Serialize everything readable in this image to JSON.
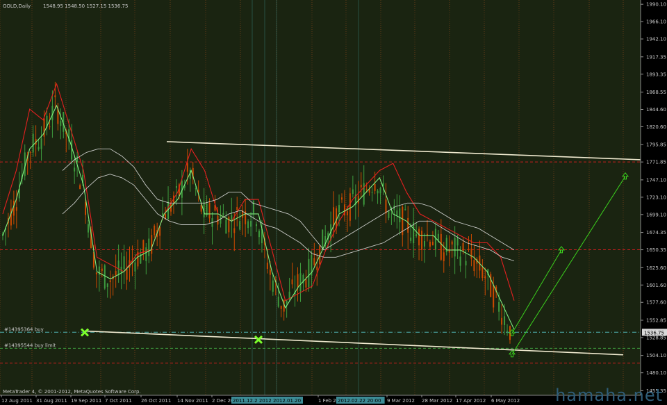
{
  "header": {
    "symbol": "GOLD,Daily",
    "ohlc": "1548.95  1548.50  1527.15  1536.75"
  },
  "footer": {
    "copyright": "MetaTrader 4, © 2001-2012, MetaQuotes Software Corp."
  },
  "watermark": "hamaha.net",
  "order_labels": [
    {
      "text": "#14395364 buy",
      "price": 1536.2
    },
    {
      "text": "#14395544 buy limit",
      "price": 1514.0
    }
  ],
  "time_markers": [
    "2011.12.2 2012.01",
    "2012.01.20",
    "2012.02.22 20:00"
  ],
  "colors": {
    "background": "#000000",
    "plot_background": "#1a2411",
    "axis_text": "#c8c8c8",
    "grid": "#c85a1e",
    "candle_up": "#3e9b3e",
    "candle_down": "#cc4a00",
    "ma_red": "#e52020",
    "ma_green": "#80ee80",
    "envelope": "#e8e8e8",
    "trend_line": "#f0ead0",
    "dashed_red": "#c81e1e",
    "dashed_cyan": "#4fb4b4",
    "dashed_green": "#40a040",
    "cross_marker": "#7cff2c",
    "arrow_green": "#3cd21e",
    "price_box": "#d8d8d8"
  },
  "chart_data": {
    "type": "line",
    "title": "GOLD,Daily",
    "x_labels": [
      "12 Aug 2011",
      "31 Aug 2011",
      "19 Sep 2011",
      "7 Oct 2011",
      "26 Oct 2011",
      "14 Nov 2011",
      "2 Dec 2011",
      "1 Feb 2012",
      "9 Mar 2012",
      "28 Mar 2012",
      "17 Apr 2012",
      "6 May 2012"
    ],
    "y_ticks": [
      1990.1,
      1966.1,
      1942.1,
      1917.35,
      1893.35,
      1868.55,
      1844.6,
      1820.6,
      1795.85,
      1771.85,
      1747.1,
      1723.1,
      1699.1,
      1674.35,
      1650.35,
      1625.6,
      1601.6,
      1577.6,
      1552.85,
      1528.85,
      1504.1,
      1480.1,
      1455.35
    ],
    "ylim": [
      1449,
      1996
    ],
    "current_price": "1536.75",
    "dashed_levels": [
      {
        "price": 1771.85,
        "style": "red"
      },
      {
        "price": 1650.35,
        "style": "red"
      },
      {
        "price": 1536.2,
        "style": "cyan"
      },
      {
        "price": 1514.0,
        "style": "green"
      },
      {
        "price": 1493.5,
        "style": "red"
      }
    ],
    "series": [
      {
        "style": "ma_red",
        "y": [
          1700,
          1760,
          1845,
          1830,
          1880,
          1820,
          1760,
          1640,
          1630,
          1620,
          1645,
          1650,
          1700,
          1730,
          1790,
          1760,
          1700,
          1690,
          1720,
          1720,
          1650,
          1580,
          1590,
          1600,
          1650,
          1690,
          1720,
          1740,
          1760,
          1770,
          1730,
          1700,
          1690,
          1680,
          1670,
          1660,
          1660,
          1640,
          1580
        ]
      },
      {
        "style": "ma_green",
        "y": [
          1670,
          1720,
          1790,
          1810,
          1850,
          1800,
          1740,
          1620,
          1610,
          1620,
          1640,
          1650,
          1700,
          1720,
          1760,
          1700,
          1700,
          1690,
          1700,
          1700,
          1620,
          1570,
          1600,
          1620,
          1660,
          1700,
          1710,
          1730,
          1750,
          1700,
          1690,
          1670,
          1670,
          1650,
          1650,
          1640,
          1620,
          1580,
          1540
        ]
      },
      {
        "style": "envelope",
        "y": [
          1760,
          1775,
          1785,
          1790,
          1790,
          1780,
          1765,
          1740,
          1720,
          1715,
          1715,
          1715,
          1715,
          1720,
          1730,
          1730,
          1715,
          1710,
          1705,
          1700,
          1690,
          1670,
          1650,
          1660,
          1670,
          1680,
          1690,
          1700,
          1710,
          1715,
          1715,
          1710,
          1700,
          1690,
          1685,
          1680,
          1670,
          1660,
          1650
        ]
      },
      {
        "style": "envelope",
        "y": [
          1700,
          1715,
          1735,
          1750,
          1755,
          1750,
          1740,
          1720,
          1700,
          1690,
          1685,
          1685,
          1685,
          1690,
          1700,
          1705,
          1695,
          1685,
          1680,
          1670,
          1660,
          1645,
          1640,
          1640,
          1645,
          1650,
          1655,
          1660,
          1670,
          1680,
          1690,
          1690,
          1680,
          1670,
          1660,
          1655,
          1650,
          1640,
          1635
        ]
      }
    ],
    "trend_lines": [
      {
        "from": [
          "1 Oct 2011",
          1800
        ],
        "to": [
          "27 May 2012",
          1775
        ],
        "y_from": 1800,
        "y_to": 1775
      },
      {
        "y_from": 1538,
        "y_to": 1505
      }
    ],
    "markers": [
      {
        "type": "cross",
        "price": 1536
      },
      {
        "type": "cross",
        "price": 1526
      },
      {
        "type": "arrow",
        "price": 1535
      },
      {
        "type": "arrow",
        "price": 1506
      },
      {
        "type": "arrow",
        "price": 1650
      },
      {
        "type": "arrow",
        "price": 1752
      }
    ]
  }
}
